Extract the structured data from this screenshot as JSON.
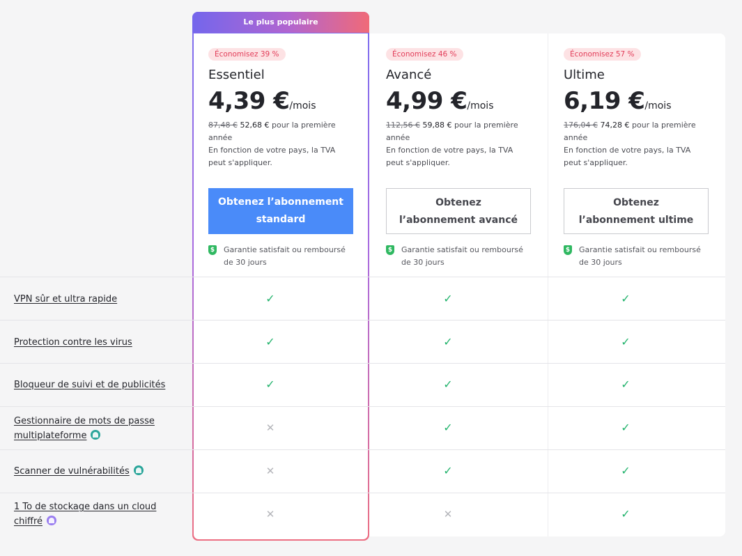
{
  "popular_label": "Le plus populaire",
  "plans": [
    {
      "savings": "Économisez 39 %",
      "name": "Essentiel",
      "price": "4,39 €",
      "per": "/mois",
      "old_price": "87,48 €",
      "new_price": "52,68 €",
      "period_text": "pour la première année",
      "tax_note": "En fonction de votre pays, la TVA peut s'appliquer.",
      "cta": "Obtenez l’abonnement standard",
      "guarantee": "Garantie satisfait ou remboursé de 30 jours"
    },
    {
      "savings": "Économisez 46 %",
      "name": "Avancé",
      "price": "4,99 €",
      "per": "/mois",
      "old_price": "112,56 €",
      "new_price": "59,88 €",
      "period_text": "pour la première année",
      "tax_note": "En fonction de votre pays, la TVA peut s'appliquer.",
      "cta": "Obtenez l’abonnement avancé",
      "guarantee": "Garantie satisfait ou remboursé de 30 jours"
    },
    {
      "savings": "Économisez 57 %",
      "name": "Ultime",
      "price": "6,19 €",
      "per": "/mois",
      "old_price": "176,04 €",
      "new_price": "74,28 €",
      "period_text": "pour la première année",
      "tax_note": "En fonction de votre pays, la TVA peut s'appliquer.",
      "cta": "Obtenez l’abonnement ultime",
      "guarantee": "Garantie satisfait ou remboursé de 30 jours"
    }
  ],
  "features": [
    {
      "label": "VPN sûr et ultra rapide",
      "icon": "",
      "included": [
        true,
        true,
        true
      ]
    },
    {
      "label": "Protection contre les virus",
      "icon": "",
      "included": [
        true,
        true,
        true
      ]
    },
    {
      "label": "Bloqueur de suivi et de publicités",
      "icon": "",
      "included": [
        true,
        true,
        true
      ]
    },
    {
      "label": "Gestionnaire de mots de passe multiplateforme",
      "icon": "password-manager-badge-icon",
      "included": [
        false,
        true,
        true
      ]
    },
    {
      "label": "Scanner de vulnérabilités",
      "icon": "vulnerability-scanner-badge-icon",
      "included": [
        false,
        true,
        true
      ]
    },
    {
      "label": "1 To de stockage dans un cloud chiffré",
      "icon": "cloud-storage-badge-icon",
      "included": [
        false,
        false,
        true
      ]
    }
  ],
  "glyphs": {
    "check": "✓",
    "cross": "✕",
    "dollar": "$"
  },
  "colors": {
    "primary_button": "#4a8bf9",
    "savings_text": "#e23d59",
    "savings_bg": "#fde2e4",
    "check": "#22b36c",
    "popular_gradient_start": "#7466ec",
    "popular_gradient_end": "#f06a78"
  }
}
